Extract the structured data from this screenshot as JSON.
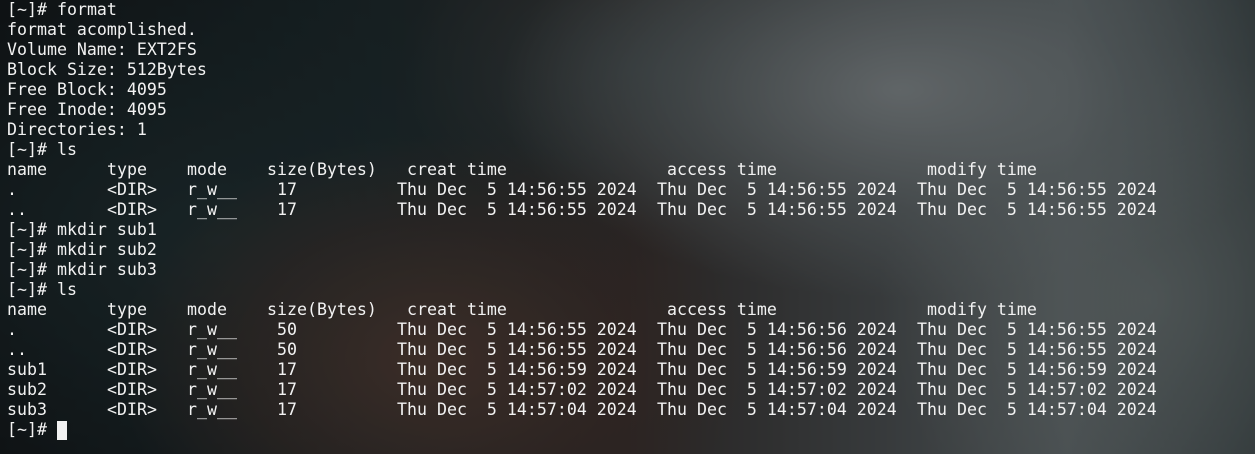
{
  "prompt": "[~]#",
  "block1": {
    "command": "format",
    "output": [
      "format acomplished.",
      "Volume Name: EXT2FS",
      "Block Size: 512Bytes",
      "Free Block: 4095",
      "Free Inode: 4095",
      "Directories: 1"
    ]
  },
  "ls1": {
    "command": "ls",
    "header": {
      "name": "name",
      "type": "type",
      "mode": "mode",
      "size": "size(Bytes)",
      "creat": "creat time",
      "access": "access time",
      "modify": "modify time"
    },
    "rows": [
      {
        "name": ".",
        "type": "<DIR>",
        "mode": "r_w__",
        "size": "17",
        "creat": "Thu Dec  5 14:56:55 2024",
        "access": "Thu Dec  5 14:56:55 2024",
        "modify": "Thu Dec  5 14:56:55 2024"
      },
      {
        "name": "..",
        "type": "<DIR>",
        "mode": "r_w__",
        "size": "17",
        "creat": "Thu Dec  5 14:56:55 2024",
        "access": "Thu Dec  5 14:56:55 2024",
        "modify": "Thu Dec  5 14:56:55 2024"
      }
    ]
  },
  "mkdirs": [
    "mkdir sub1",
    "mkdir sub2",
    "mkdir sub3"
  ],
  "ls2": {
    "command": "ls",
    "rows": [
      {
        "name": ".",
        "type": "<DIR>",
        "mode": "r_w__",
        "size": "50",
        "creat": "Thu Dec  5 14:56:55 2024",
        "access": "Thu Dec  5 14:56:56 2024",
        "modify": "Thu Dec  5 14:56:55 2024"
      },
      {
        "name": "..",
        "type": "<DIR>",
        "mode": "r_w__",
        "size": "50",
        "creat": "Thu Dec  5 14:56:55 2024",
        "access": "Thu Dec  5 14:56:56 2024",
        "modify": "Thu Dec  5 14:56:55 2024"
      },
      {
        "name": "sub1",
        "type": "<DIR>",
        "mode": "r_w__",
        "size": "17",
        "creat": "Thu Dec  5 14:56:59 2024",
        "access": "Thu Dec  5 14:56:59 2024",
        "modify": "Thu Dec  5 14:56:59 2024"
      },
      {
        "name": "sub2",
        "type": "<DIR>",
        "mode": "r_w__",
        "size": "17",
        "creat": "Thu Dec  5 14:57:02 2024",
        "access": "Thu Dec  5 14:57:02 2024",
        "modify": "Thu Dec  5 14:57:02 2024"
      },
      {
        "name": "sub3",
        "type": "<DIR>",
        "mode": "r_w__",
        "size": "17",
        "creat": "Thu Dec  5 14:57:04 2024",
        "access": "Thu Dec  5 14:57:04 2024",
        "modify": "Thu Dec  5 14:57:04 2024"
      }
    ]
  },
  "colors": {
    "text": "#f2f2f2",
    "background": "#151a1c"
  }
}
